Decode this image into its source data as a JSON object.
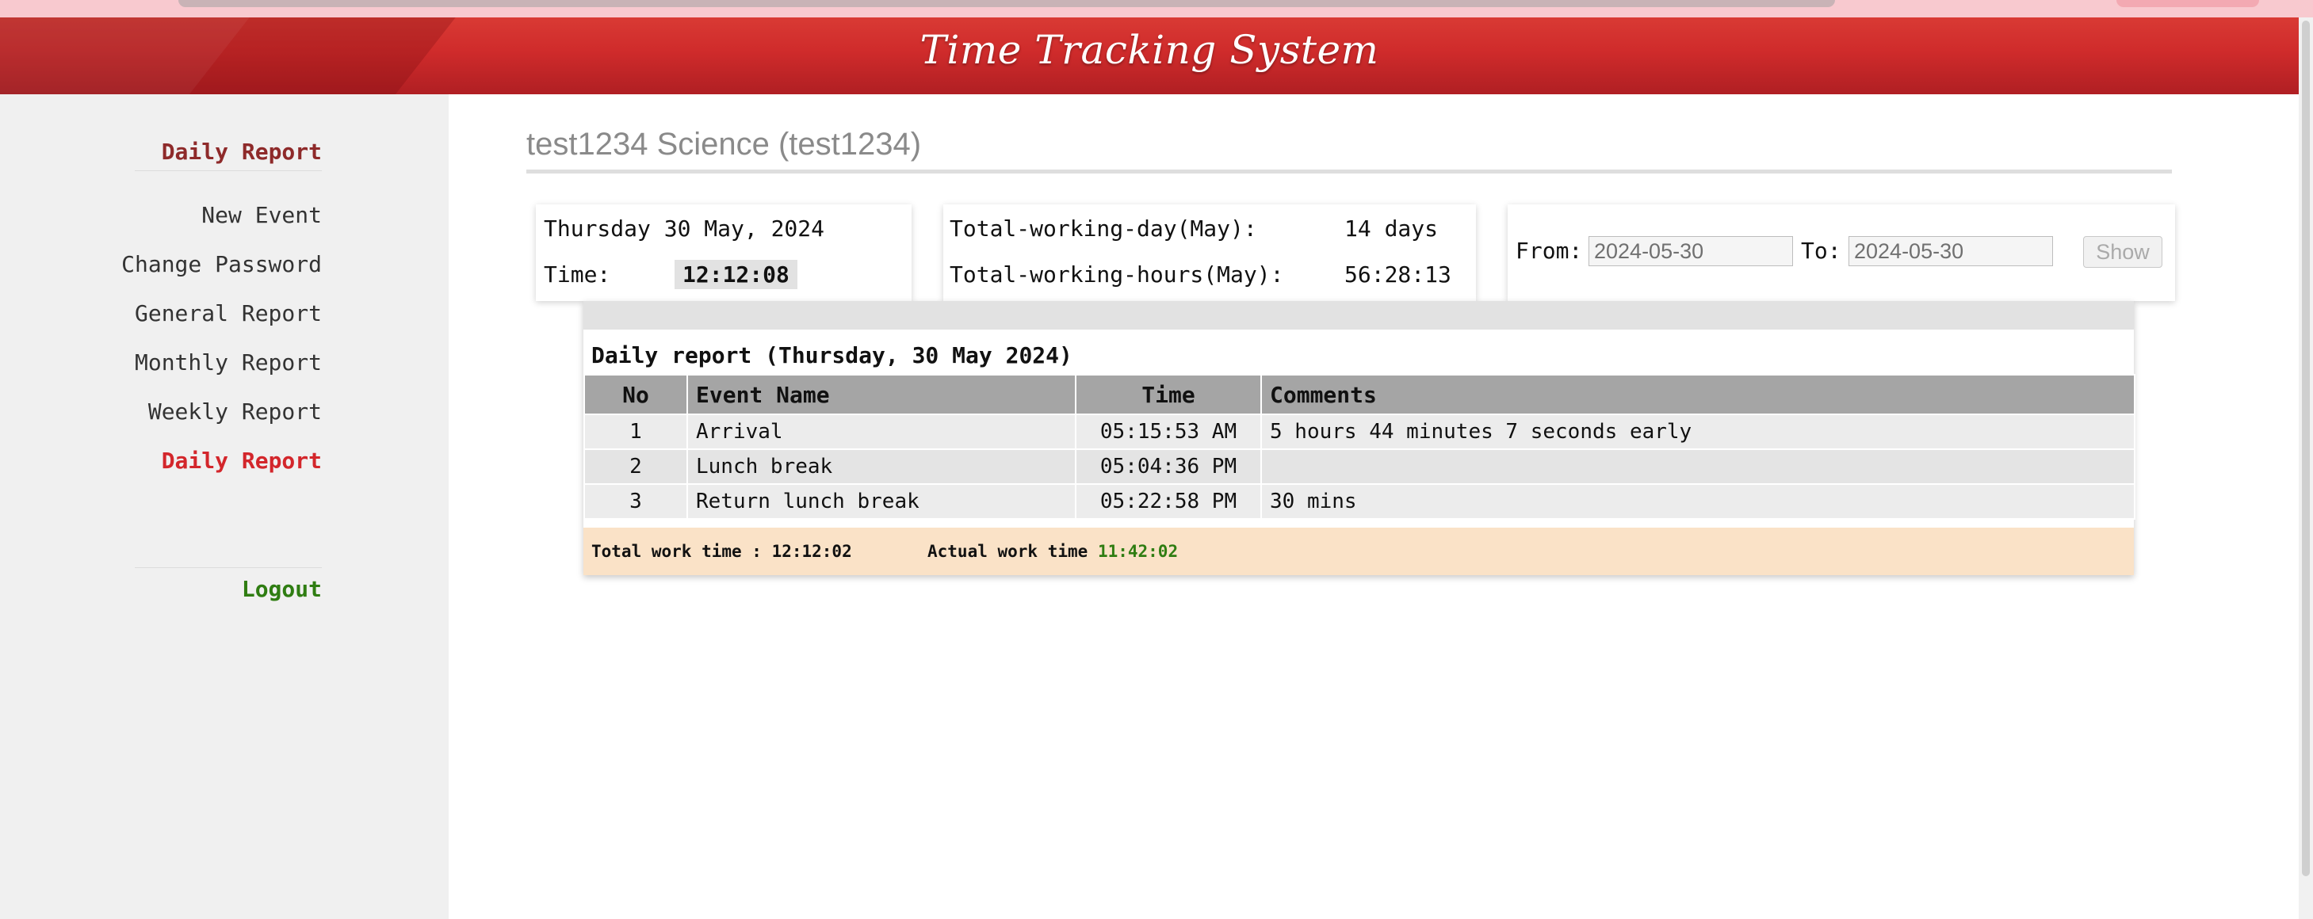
{
  "header": {
    "title": "Time Tracking System"
  },
  "sidebar": {
    "top_label": "Daily Report",
    "items": [
      {
        "label": "New Event"
      },
      {
        "label": "Change Password"
      },
      {
        "label": "General Report"
      },
      {
        "label": "Monthly Report"
      },
      {
        "label": "Weekly Report"
      },
      {
        "label": "Daily Report"
      }
    ],
    "logout_label": "Logout"
  },
  "main": {
    "page_title": "test1234 Science (test1234)",
    "date_card": {
      "date": "Thursday 30 May, 2024",
      "time_label": "Time:",
      "time_value": "12:12:08"
    },
    "totals_card": {
      "days_label": "Total-working-day(May):",
      "days_value": "14 days",
      "hours_label": "Total-working-hours(May):",
      "hours_value": "56:28:13"
    },
    "filter": {
      "from_label": "From:",
      "from_value": "2024-05-30",
      "to_label": "To:",
      "to_value": "2024-05-30",
      "show_label": "Show"
    },
    "report": {
      "title": "Daily report (Thursday, 30 May 2024)",
      "columns": [
        "No",
        "Event Name",
        "Time",
        "Comments"
      ],
      "rows": [
        {
          "no": "1",
          "event": "Arrival",
          "time": "05:15:53 AM",
          "comment": "5 hours 44 minutes 7 seconds early"
        },
        {
          "no": "2",
          "event": "Lunch break",
          "time": "05:04:36 PM",
          "comment": ""
        },
        {
          "no": "3",
          "event": "Return lunch break",
          "time": "05:22:58 PM",
          "comment": "30 mins"
        }
      ],
      "total_label": "Total work time : 12:12:02",
      "actual_label": "Actual work time",
      "actual_value": "11:42:02"
    }
  }
}
